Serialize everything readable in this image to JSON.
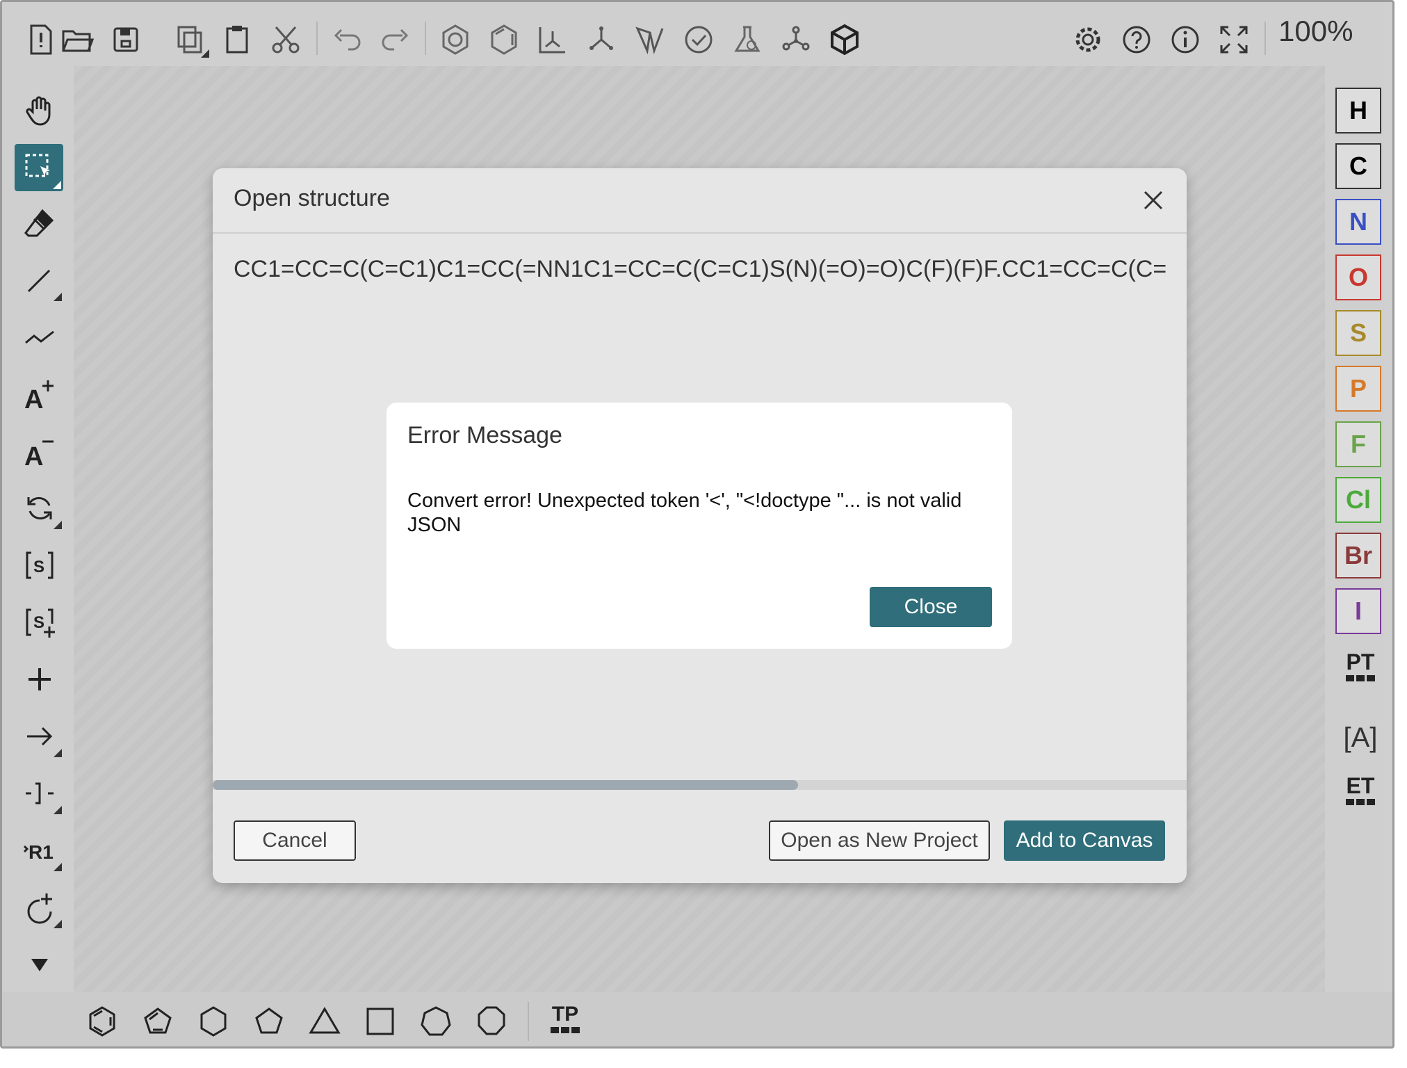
{
  "toolbar": {
    "zoom": "100%",
    "top_icons": [
      "new-file-icon",
      "open-folder-icon",
      "save-icon",
      "copy-icon",
      "paste-icon",
      "cut-icon",
      "undo-icon",
      "redo-icon",
      "aromatize-icon",
      "dearomatize-icon",
      "layout-icon",
      "clean-up-icon",
      "stereo-icon",
      "check-icon",
      "calculated-values-icon",
      "3d-molecule-icon",
      "cube-icon",
      "settings-icon",
      "help-icon",
      "info-icon",
      "fullscreen-icon"
    ]
  },
  "left_tools": [
    "hand-icon",
    "select-icon",
    "eraser-icon",
    "single-bond-icon",
    "chain-icon",
    "charge-plus-icon",
    "charge-minus-icon",
    "rotate-icon",
    "sgroup-icon",
    "sgroup-add-icon",
    "plus-icon",
    "arrow-icon",
    "bracket-icon",
    "rgroup-icon",
    "attach-icon",
    "more-icon"
  ],
  "atoms": [
    {
      "symbol": "H",
      "color": "#222222"
    },
    {
      "symbol": "C",
      "color": "#222222"
    },
    {
      "symbol": "N",
      "color": "#3b4fc4"
    },
    {
      "symbol": "O",
      "color": "#c8382f"
    },
    {
      "symbol": "S",
      "color": "#a88a2d"
    },
    {
      "symbol": "P",
      "color": "#d47a2a"
    },
    {
      "symbol": "F",
      "color": "#6aa34a"
    },
    {
      "symbol": "Cl",
      "color": "#4caa3c"
    },
    {
      "symbol": "Br",
      "color": "#8a3a3a"
    },
    {
      "symbol": "I",
      "color": "#7a3a9a"
    }
  ],
  "right_extra": [
    "PT",
    "[A]",
    "ET"
  ],
  "bottom_shapes": [
    "benzene-icon",
    "cyclopentadiene-icon",
    "cyclohexane-icon",
    "cyclopentane-icon",
    "cyclopropane-icon",
    "cyclobutane-icon",
    "cycloheptane-icon",
    "cyclooctane-icon",
    "TP"
  ],
  "open_dialog": {
    "title": "Open structure",
    "smiles": "CC1=CC=C(C=C1)C1=CC(=NN1C1=CC=C(C=C1)S(N)(=O)=O)C(F)(F)F.CC1=CC=C(C=",
    "cancel_label": "Cancel",
    "open_new_label": "Open as New Project",
    "add_label": "Add to Canvas"
  },
  "error_dialog": {
    "title": "Error Message",
    "message": "Convert error! Unexpected token '<', \"<!doctype \"... is not valid JSON",
    "close_label": "Close"
  },
  "colors": {
    "accent": "#2f6e7a"
  }
}
